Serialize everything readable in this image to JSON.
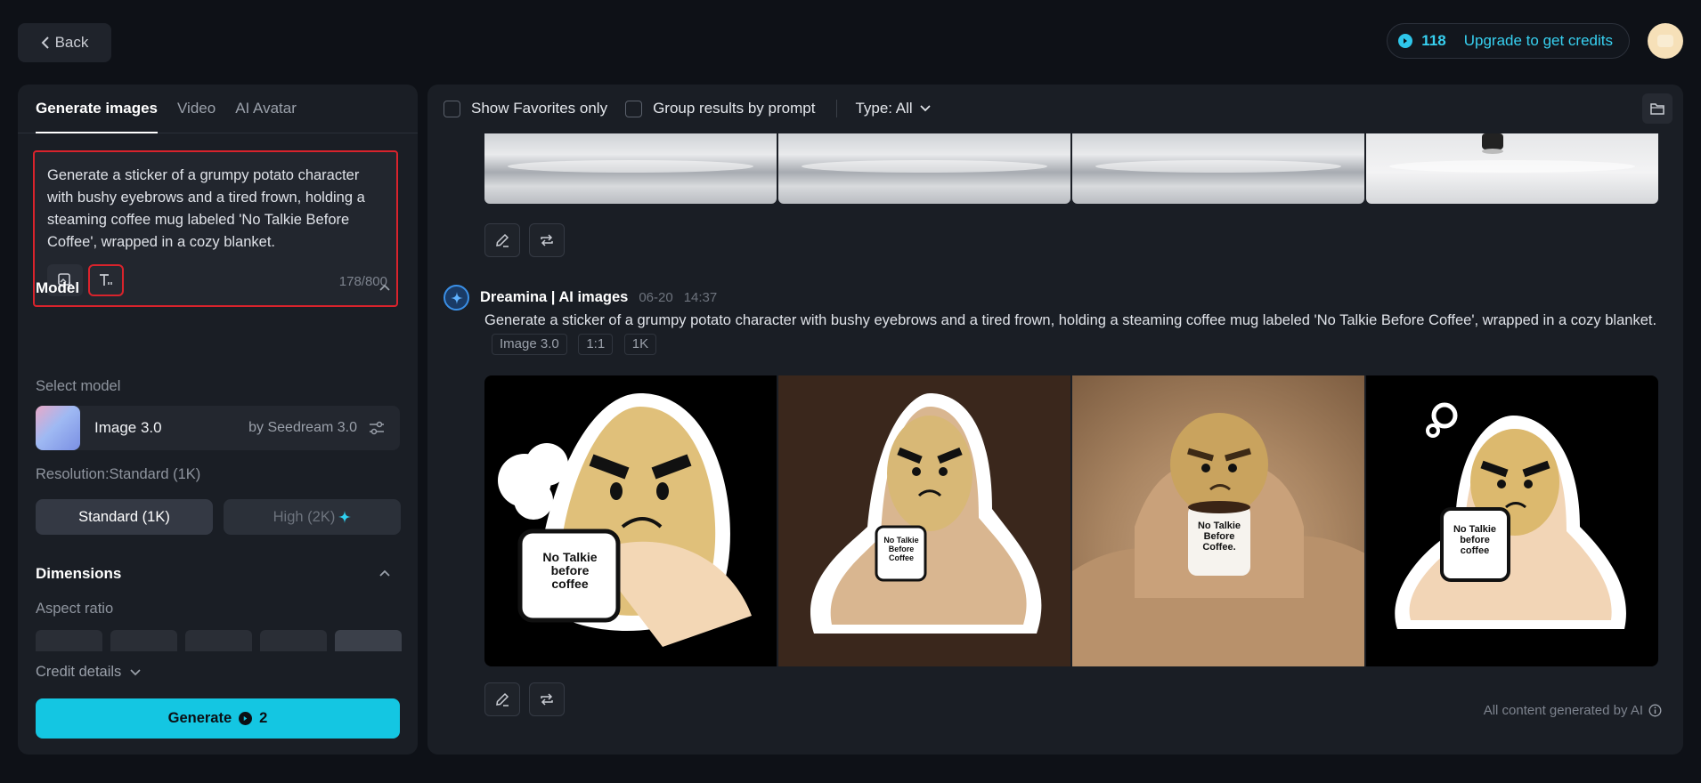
{
  "header": {
    "back_label": "Back",
    "credits": "118",
    "upgrade_label": "Upgrade to get credits"
  },
  "left": {
    "tabs": [
      {
        "label": "Generate images",
        "active": true
      },
      {
        "label": "Video",
        "active": false
      },
      {
        "label": "AI Avatar",
        "active": false
      }
    ],
    "prompt": {
      "text": "Generate a sticker of a grumpy potato character with bushy eyebrows and a tired frown, holding a steaming coffee mug labeled 'No Talkie Before Coffee', wrapped in a cozy blanket.",
      "char_count": "178/800"
    },
    "model": {
      "heading": "Model",
      "select_label": "Select model",
      "name": "Image 3.0",
      "by": "by Seedream 3.0"
    },
    "resolution": {
      "label": "Resolution:Standard (1K)",
      "standard": "Standard (1K)",
      "high": "High (2K)"
    },
    "dimensions": {
      "heading": "Dimensions",
      "aspect_label": "Aspect ratio"
    },
    "credit_details": "Credit details",
    "generate": {
      "label": "Generate",
      "cost": "2"
    }
  },
  "right": {
    "filters": {
      "favorites": "Show Favorites only",
      "group": "Group results by prompt",
      "type": "Type: All"
    },
    "generation": {
      "source": "Dreamina | AI images",
      "date": "06-20",
      "time": "14:37",
      "prompt": "Generate a sticker of a grumpy potato character with bushy eyebrows and a tired frown, holding a steaming coffee mug labeled 'No Talkie Before Coffee', wrapped in a cozy blanket.",
      "tags": [
        "Image 3.0",
        "1:1",
        "1K"
      ],
      "mug_texts": [
        "No Talkie before coffee",
        "No Talkie Before Coffee",
        "No Talkie Before Coffee.",
        "No Talkie before coffee"
      ]
    },
    "footer_note": "All content generated by AI"
  },
  "colors": {
    "accent": "#14c6e2",
    "highlight": "#d9232c",
    "background": "#0e1117",
    "panel": "#1a1e25"
  }
}
